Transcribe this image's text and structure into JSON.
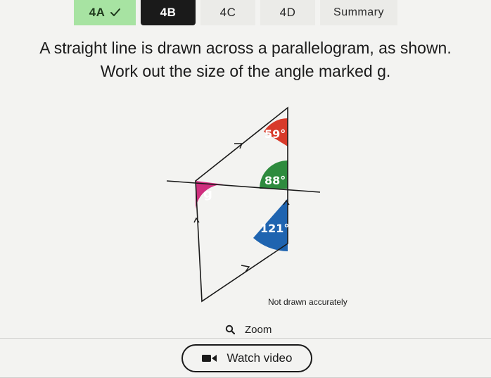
{
  "tabs": [
    {
      "label": "4A",
      "completed": true
    },
    {
      "label": "4B",
      "active": true
    },
    {
      "label": "4C"
    },
    {
      "label": "4D"
    },
    {
      "label": "Summary"
    }
  ],
  "question": {
    "line1": "A straight line is drawn across a parallelogram, as shown.",
    "line2": "Work out the size of the angle marked g."
  },
  "diagram": {
    "angles": [
      {
        "label": "59°",
        "color": "#d83a2a"
      },
      {
        "label": "88°",
        "color": "#2e8b3e"
      },
      {
        "label": "g",
        "color": "#cf2f7e"
      },
      {
        "label": "121°",
        "color": "#1f64b0"
      }
    ],
    "note": "Not drawn accurately"
  },
  "zoom": {
    "label": "Zoom",
    "icon": "magnifier-icon"
  },
  "video": {
    "label": "Watch video",
    "icon": "video-camera-icon"
  },
  "colors": {
    "tab_completed": "#a7e3a2",
    "tab_active": "#1a1a1a",
    "tab_inactive": "#ebebe8",
    "background": "#f3f3f1"
  }
}
